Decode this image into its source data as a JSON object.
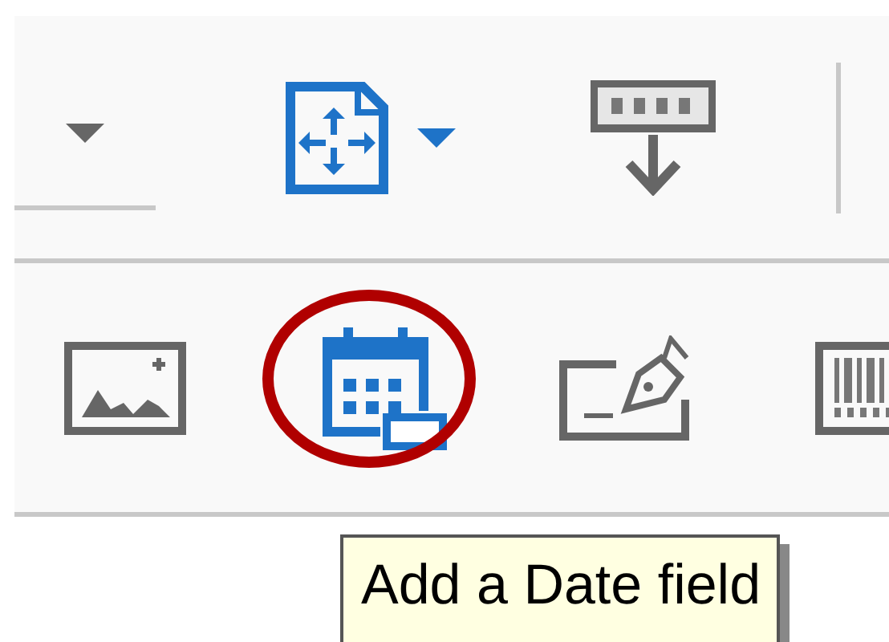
{
  "toolbar_rows": [
    {
      "items": [
        {
          "kind": "dropdown-partial",
          "highlighted": false
        },
        {
          "kind": "document-move",
          "highlighted": false
        },
        {
          "kind": "dropdown-caret",
          "highlighted": false
        },
        {
          "kind": "keyboard-down",
          "highlighted": false
        },
        {
          "kind": "separator",
          "highlighted": false
        }
      ]
    },
    {
      "items": [
        {
          "kind": "image",
          "highlighted": false
        },
        {
          "kind": "calendar",
          "highlighted": true
        },
        {
          "kind": "signature",
          "highlighted": false
        },
        {
          "kind": "barcode",
          "highlighted": false
        }
      ]
    }
  ],
  "tooltip": {
    "text": "Add a Date field"
  }
}
